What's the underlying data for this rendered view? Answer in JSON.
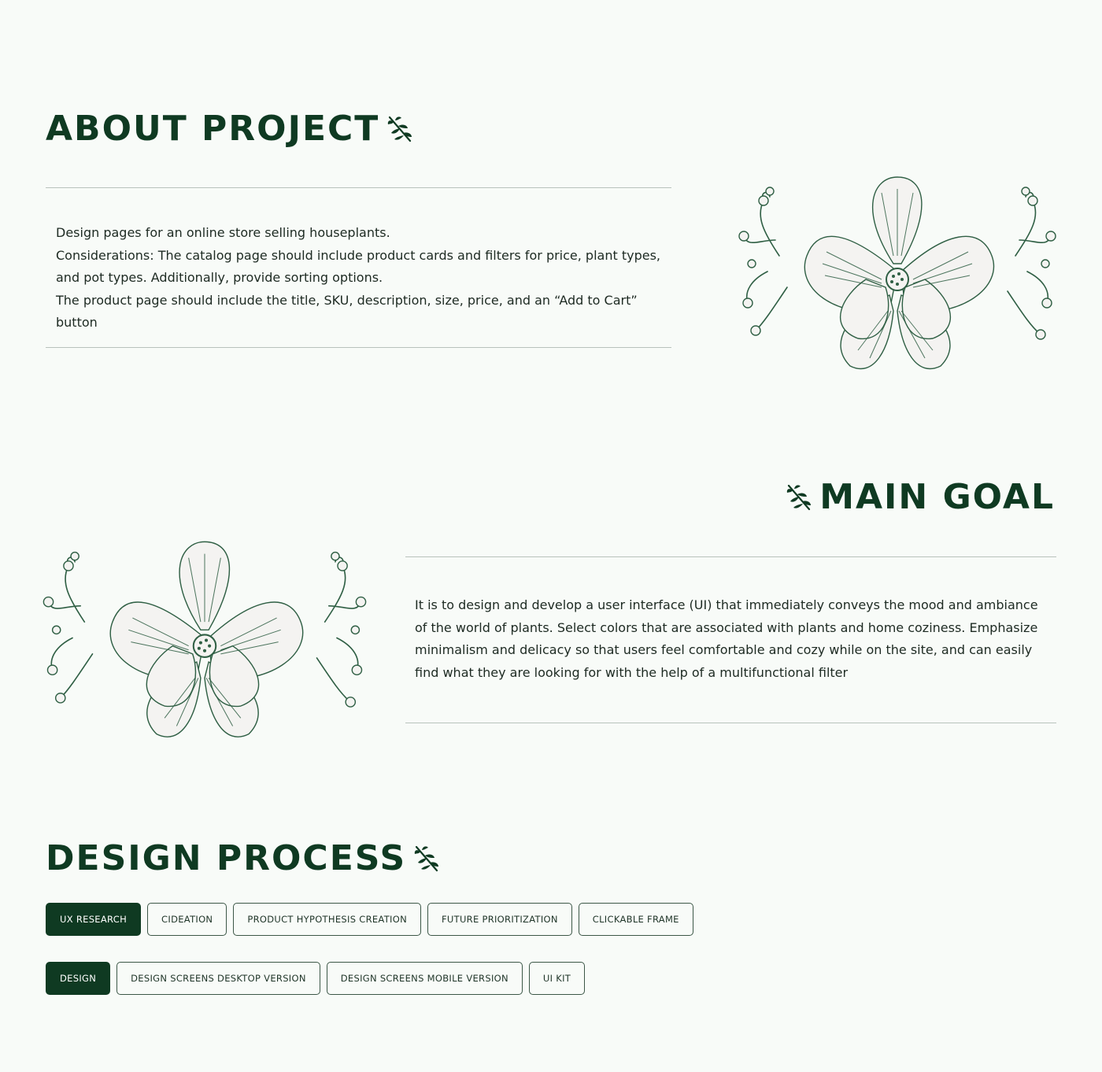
{
  "colors": {
    "accent": "#0f3a22",
    "background": "#f8fbf8",
    "rule": "#b9c2bc",
    "text": "#1d2a22"
  },
  "icons": {
    "heading_ornament": "leaf-sprig-icon",
    "illustration": "peony-flower"
  },
  "about": {
    "title": "ABOUT PROJECT",
    "lines": [
      "Design pages for an online store selling houseplants.",
      "Considerations: The catalog page should include product cards and filters for price, plant types,",
      "and pot types. Additionally, provide sorting options.",
      "The product page should include the title, SKU, description, size, price, and an “Add to Cart” button"
    ]
  },
  "main_goal": {
    "title": "MAIN GOAL",
    "lines": [
      "It is to design and develop a user interface (UI) that immediately conveys the mood and ambiance",
      "of the world of plants. Select colors that are associated with plants and home coziness. Emphasize",
      "minimalism and delicacy so that users feel comfortable and cozy while on the site, and can easily",
      "find what they are looking for with the help of a multifunctional filter"
    ]
  },
  "design_process": {
    "title": "DESIGN PROCESS",
    "rows": [
      {
        "items": [
          "UX RESEARCH",
          "CIDEATION",
          "PRODUCT HYPOTHESIS CREATION",
          "FUTURE PRIORITIZATION",
          "CLICKABLE FRAME"
        ]
      },
      {
        "items": [
          "DESIGN",
          "DESIGN SCREENS DESKTOP VERSION",
          "DESIGN SCREENS MOBILE VERSION",
          "UI KIT"
        ]
      }
    ]
  }
}
